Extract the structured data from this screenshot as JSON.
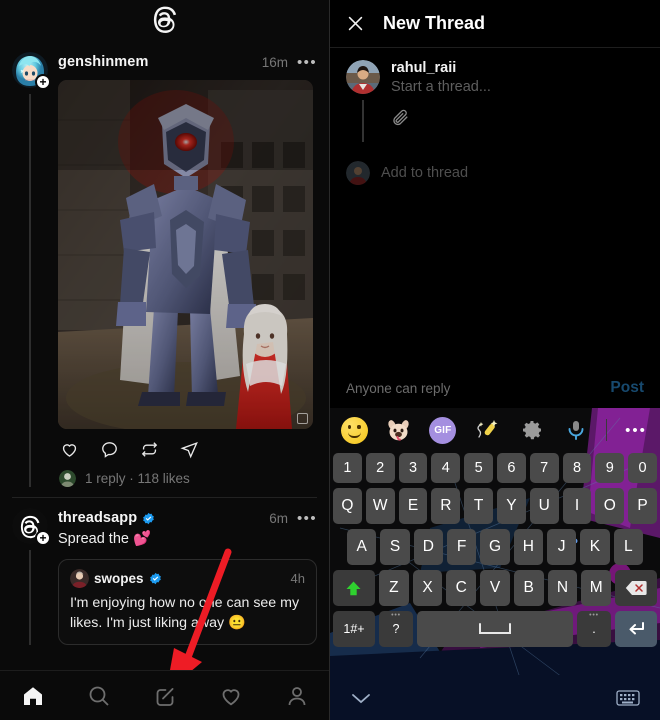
{
  "feed": {
    "app_logo": "threads-logo",
    "posts": [
      {
        "username": "genshinmem",
        "verified": false,
        "timestamp": "16m",
        "menu": "•••",
        "text": "",
        "has_image": true,
        "image_alt": "cosplay photo of armored mech character with glowing red eye and a girl in red dress",
        "actions": [
          "like-icon",
          "reply-icon",
          "repost-icon",
          "share-icon"
        ],
        "meta": "1 reply · 118 likes",
        "replies": 1,
        "likes": 118
      },
      {
        "username": "threadsapp",
        "verified": true,
        "timestamp": "6m",
        "menu": "•••",
        "text": "Spread the 💕",
        "has_image": false,
        "quote": {
          "username": "swopes",
          "verified": true,
          "timestamp": "4h",
          "text": "I'm enjoying how no one can see my likes. I'm just liking away 😐"
        }
      }
    ],
    "bottom_nav": [
      {
        "name": "home",
        "icon": "home-icon",
        "active": true
      },
      {
        "name": "search",
        "icon": "search-icon",
        "active": false
      },
      {
        "name": "compose",
        "icon": "compose-icon",
        "active": false
      },
      {
        "name": "activity",
        "icon": "heart-icon",
        "active": false
      },
      {
        "name": "profile",
        "icon": "person-icon",
        "active": false
      }
    ],
    "annotation": {
      "type": "red-arrow",
      "points_to": "compose-icon",
      "color": "#ee1c25"
    }
  },
  "composer": {
    "close_icon": "close-icon",
    "title": "New Thread",
    "username": "rahul_raii",
    "placeholder": "Start a thread...",
    "attach_icon": "paperclip-icon",
    "add_to_thread": "Add to thread",
    "reply_setting": "Anyone can reply",
    "post_label": "Post",
    "post_enabled": false,
    "post_color": "#17496e"
  },
  "keyboard": {
    "toolbar": [
      {
        "name": "emoji-icon",
        "label": "🙂"
      },
      {
        "name": "sticker-icon",
        "label": "🐶"
      },
      {
        "name": "gif-icon",
        "label": "GIF"
      },
      {
        "name": "magic-wand-icon",
        "label": "✨"
      },
      {
        "name": "settings-icon",
        "label": "⚙"
      },
      {
        "name": "microphone-icon",
        "label": "🎤"
      },
      {
        "name": "more-icon",
        "label": "•••"
      }
    ],
    "rows": {
      "numbers": [
        "1",
        "2",
        "3",
        "4",
        "5",
        "6",
        "7",
        "8",
        "9",
        "0"
      ],
      "top": [
        "Q",
        "W",
        "E",
        "R",
        "T",
        "Y",
        "U",
        "I",
        "O",
        "P"
      ],
      "home": [
        "A",
        "S",
        "D",
        "F",
        "G",
        "H",
        "J",
        "K",
        "L"
      ],
      "bottom": [
        "Z",
        "X",
        "C",
        "V",
        "B",
        "N",
        "M"
      ]
    },
    "shift_key": "shift-icon",
    "backspace_key": "backspace-icon",
    "symbols_key": "1#+",
    "question_key": "?",
    "space_key": "space-icon",
    "period_key": ".",
    "enter_key": "enter-icon",
    "navbar": {
      "hide_keyboard": "chevron-down-icon",
      "switch_keyboard": "keyboard-icon"
    }
  },
  "colors": {
    "background": "#0a0a0a",
    "verified_blue": "#1d9bf0",
    "key_bg": "#4a4a4a",
    "shift_green": "#2fd12f",
    "gif_purple": "#a48fe0",
    "navbar_navy": "#071026"
  }
}
